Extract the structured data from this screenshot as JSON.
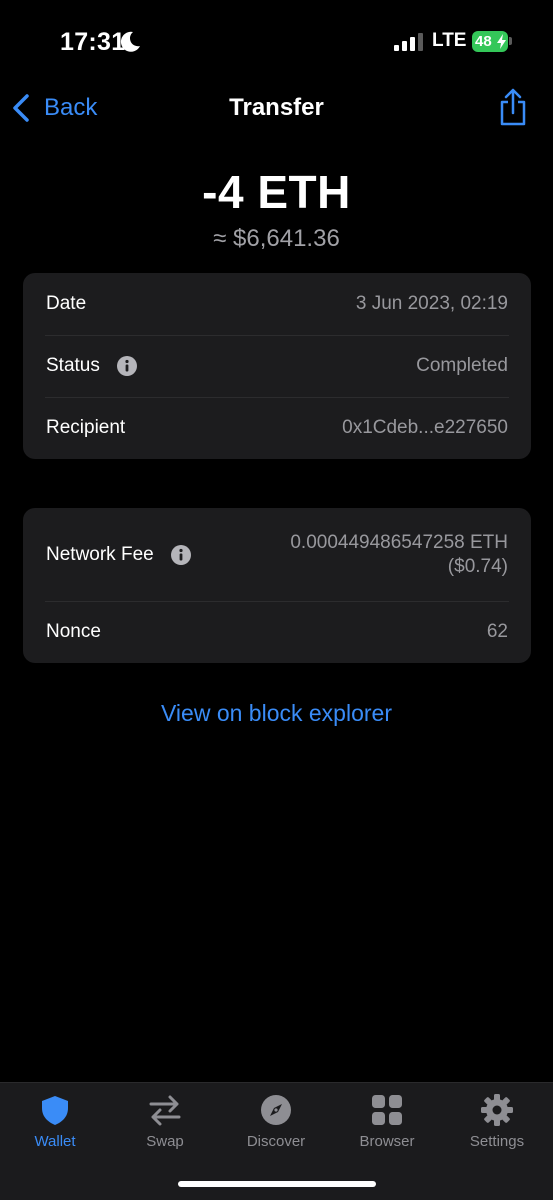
{
  "status_bar": {
    "time": "17:31",
    "network": "LTE",
    "battery": "48"
  },
  "nav": {
    "back_label": "Back",
    "title": "Transfer"
  },
  "transaction": {
    "amount": "-4 ETH",
    "fiat": "≈ $6,641.36"
  },
  "details": [
    {
      "label": "Date",
      "value": "3 Jun 2023, 02:19"
    },
    {
      "label": "Status",
      "value": "Completed"
    },
    {
      "label": "Recipient",
      "value": "0x1Cdeb...e227650"
    }
  ],
  "fees": {
    "network_fee_label": "Network Fee",
    "network_fee_value": "0.000449486547258 ETH",
    "network_fee_fiat": "($0.74)",
    "nonce_label": "Nonce",
    "nonce_value": "62"
  },
  "explorer_link": "View on block explorer",
  "tabs": [
    {
      "label": "Wallet",
      "icon": "shield-icon",
      "active": true
    },
    {
      "label": "Swap",
      "icon": "swap-arrows-icon"
    },
    {
      "label": "Discover",
      "icon": "compass-icon"
    },
    {
      "label": "Browser",
      "icon": "grid-icon"
    },
    {
      "label": "Settings",
      "icon": "gear-icon"
    }
  ],
  "colors": {
    "accent": "#3a8cf7",
    "background": "#000000",
    "card": "#1c1c1e",
    "battery": "#34c759"
  }
}
